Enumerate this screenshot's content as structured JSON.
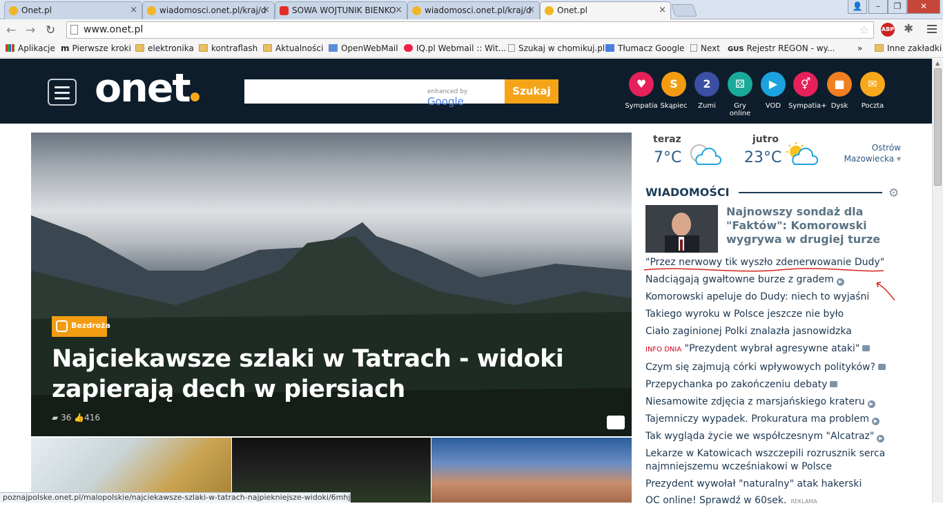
{
  "tabs": [
    {
      "title": "Onet.pl",
      "icon": "onet-favicon",
      "active": false
    },
    {
      "title": "wiadomosci.onet.pl/kraj/d",
      "icon": "onet-favicon",
      "active": false
    },
    {
      "title": "SOWA WOJTUNIK BIENKO",
      "icon": "youtube-favicon",
      "active": false
    },
    {
      "title": "wiadomosci.onet.pl/kraj/d",
      "icon": "onet-favicon",
      "active": false
    },
    {
      "title": "Onet.pl",
      "icon": "onet-favicon",
      "active": true
    }
  ],
  "address": {
    "url": "www.onet.pl"
  },
  "bookmarks": [
    {
      "label": "Aplikacje",
      "icon": "apps-grid-icon"
    },
    {
      "label": "Pierwsze kroki",
      "icon": "m-icon"
    },
    {
      "label": "elektronika",
      "icon": "folder-icon"
    },
    {
      "label": "kontraflash",
      "icon": "folder-icon"
    },
    {
      "label": "Aktualności",
      "icon": "folder-icon"
    },
    {
      "label": "OpenWebMail",
      "icon": "mail-icon"
    },
    {
      "label": "IQ.pl Webmail :: Wit...",
      "icon": "iq-icon"
    },
    {
      "label": "Szukaj w chomikuj.pl",
      "icon": "page-icon"
    },
    {
      "label": "Tłumacz Google",
      "icon": "translate-icon"
    },
    {
      "label": "Next",
      "icon": "page-icon"
    },
    {
      "label": "Rejestr REGON - wy...",
      "icon": "gus-icon"
    },
    {
      "label": "»",
      "icon": ""
    },
    {
      "label": "Inne zakładki",
      "icon": "folder-icon"
    }
  ],
  "header": {
    "logo": "onet",
    "search_enhanced": "enhanced by",
    "search_brand": "Google",
    "search_button": "Szukaj",
    "apps": [
      {
        "label": "Sympatia",
        "color": "#e5205a",
        "glyph": "♥"
      },
      {
        "label": "Skąpiec",
        "color": "#f39c12",
        "glyph": "S"
      },
      {
        "label": "Zumi",
        "color": "#3b4fa3",
        "glyph": "2"
      },
      {
        "label": "Gry online",
        "color": "#1aaa9a",
        "glyph": "⚄"
      },
      {
        "label": "VOD",
        "color": "#1ba3df",
        "glyph": "▶"
      },
      {
        "label": "Sympatia+",
        "color": "#e5205a",
        "glyph": "⚥"
      },
      {
        "label": "Dysk",
        "color": "#f07f23",
        "glyph": "■"
      },
      {
        "label": "Poczta",
        "color": "#f7a81b",
        "glyph": "✉"
      }
    ]
  },
  "hero": {
    "badge": "Bezdroża",
    "title": "Najciekawsze szlaki w Tatrach - widoki zapierają dech w piersiach",
    "comments": "36",
    "likes": "416"
  },
  "weather": {
    "now_label": "teraz",
    "now_temp": "7°C",
    "tomorrow_label": "jutro",
    "tomorrow_temp": "23°C",
    "city": "Ostrów Mazowiecka"
  },
  "news": {
    "heading": "WIADOMOŚCI",
    "top_title": "Najnowszy sondaż dla \"Faktów\": Komorowski wygrywa w drugiej turze",
    "items": [
      {
        "text": "\"Przez nerwowy tik wyszło zdenerwowanie Dudy\"",
        "prefix": "",
        "marker": ""
      },
      {
        "text": "Nadciągają gwałtowne burze z gradem",
        "prefix": "",
        "marker": "play"
      },
      {
        "text": "Komorowski apeluje do Dudy: niech to wyjaśni",
        "prefix": "",
        "marker": ""
      },
      {
        "text": "Takiego wyroku w Polsce jeszcze nie było",
        "prefix": "",
        "marker": ""
      },
      {
        "text": "Ciało zaginionej Polki znalazła jasnowidzka",
        "prefix": "",
        "marker": ""
      },
      {
        "text": "\"Prezydent wybrał agresywne ataki\"",
        "prefix": "INFO DNIA",
        "marker": "camera"
      },
      {
        "text": "Czym się zajmują córki wpływowych polityków?",
        "prefix": "",
        "marker": "camera"
      },
      {
        "text": "Przepychanka po zakończeniu debaty",
        "prefix": "",
        "marker": "camera"
      },
      {
        "text": "Niesamowite zdjęcia z marsjańskiego krateru",
        "prefix": "",
        "marker": "play"
      },
      {
        "text": "Tajemniczy wypadek. Prokuratura ma problem",
        "prefix": "",
        "marker": "play"
      },
      {
        "text": "Tak wygląda życie we współczesnym \"Alcatraz\"",
        "prefix": "",
        "marker": "play"
      },
      {
        "text": "Lekarze w Katowicach wszczepili rozrusznik serca",
        "prefix": "",
        "marker": ""
      },
      {
        "text": "najmniejszemu wcześniakowi w Polsce",
        "prefix": "",
        "marker": ""
      },
      {
        "text": "Prezydent wywołał \"naturalny\" atak hakerski",
        "prefix": "",
        "marker": ""
      },
      {
        "text": "OC online! Sprawdź w 60sek.",
        "prefix": "",
        "marker": "ad"
      }
    ],
    "ad_label": "REKLAMA"
  },
  "status": "poznajpolske.onet.pl/malopolskie/najciekawsze-szlaki-w-tatrach-najpiekniejsze-widoki/6mhjbh"
}
